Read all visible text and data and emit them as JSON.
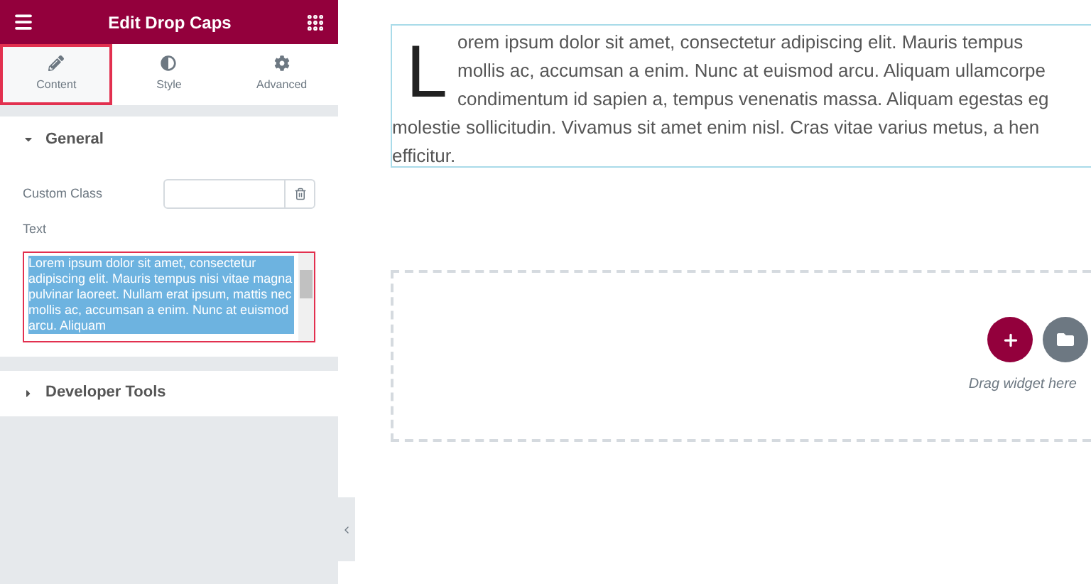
{
  "panel": {
    "title": "Edit Drop Caps",
    "tabs": [
      {
        "label": "Content",
        "selected": true
      },
      {
        "label": "Style",
        "selected": false
      },
      {
        "label": "Advanced",
        "selected": false
      }
    ],
    "sections": [
      {
        "title": "General",
        "expanded": true
      },
      {
        "title": "Developer Tools",
        "expanded": false
      }
    ],
    "fields": {
      "custom_class_label": "Custom Class",
      "text_label": "Text",
      "text_value": "Lorem ipsum dolor sit amet, consectetur adipiscing elit. Mauris tempus nisi vitae magna pulvinar laoreet. Nullam erat ipsum, mattis nec mollis ac, accumsan a enim. Nunc at euismod arcu. Aliquam"
    }
  },
  "canvas": {
    "drop_cap": "L",
    "lines": [
      "orem ipsum dolor sit amet, consectetur adipiscing elit. Mauris tempus",
      "mollis ac, accumsan a enim. Nunc at euismod arcu. Aliquam ullamcorpe",
      "condimentum id sapien a, tempus venenatis massa. Aliquam egestas eg",
      "molestie sollicitudin. Vivamus sit amet enim nisl. Cras vitae varius metus, a hen",
      "efficitur."
    ],
    "drop_hint": "Drag widget here"
  }
}
